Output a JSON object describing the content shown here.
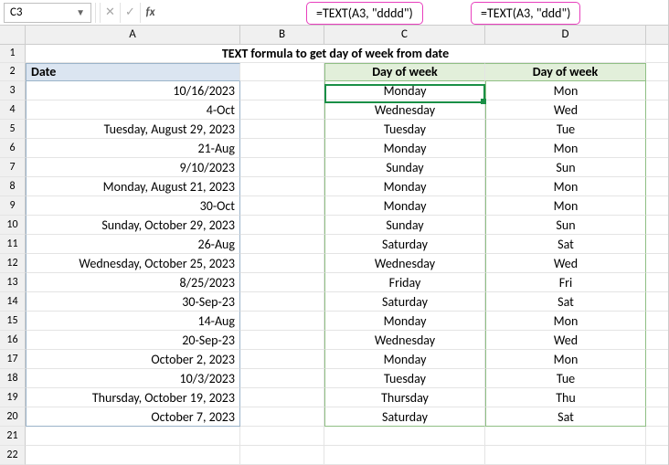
{
  "namebox": {
    "value": "C3"
  },
  "callouts": {
    "c": "=TEXT(A3, \"dddd\")",
    "d": "=TEXT(A3, \"ddd\")"
  },
  "columns": {
    "A": "A",
    "B": "B",
    "C": "C",
    "D": "D",
    "E": ""
  },
  "title": "TEXT formula to get day of week from date",
  "headers": {
    "A": "Date",
    "C": "Day of week",
    "D": "Day of week"
  },
  "rows": [
    {
      "n": "3",
      "A": "10/16/2023",
      "C": "Monday",
      "D": "Mon"
    },
    {
      "n": "4",
      "A": "4-Oct",
      "C": "Wednesday",
      "D": "Wed"
    },
    {
      "n": "5",
      "A": "Tuesday, August 29, 2023",
      "C": "Tuesday",
      "D": "Tue"
    },
    {
      "n": "6",
      "A": "21-Aug",
      "C": "Monday",
      "D": "Mon"
    },
    {
      "n": "7",
      "A": "9/10/2023",
      "C": "Sunday",
      "D": "Sun"
    },
    {
      "n": "8",
      "A": "Monday, August 21, 2023",
      "C": "Monday",
      "D": "Mon"
    },
    {
      "n": "9",
      "A": "30-Oct",
      "C": "Monday",
      "D": "Mon"
    },
    {
      "n": "10",
      "A": "Sunday, October 29, 2023",
      "C": "Sunday",
      "D": "Sun"
    },
    {
      "n": "11",
      "A": "26-Aug",
      "C": "Saturday",
      "D": "Sat"
    },
    {
      "n": "12",
      "A": "Wednesday, October 25, 2023",
      "C": "Wednesday",
      "D": "Wed"
    },
    {
      "n": "13",
      "A": "8/25/2023",
      "C": "Friday",
      "D": "Fri"
    },
    {
      "n": "14",
      "A": "30-Sep-23",
      "C": "Saturday",
      "D": "Sat"
    },
    {
      "n": "15",
      "A": "14-Aug",
      "C": "Monday",
      "D": "Mon"
    },
    {
      "n": "16",
      "A": "20-Sep-23",
      "C": "Wednesday",
      "D": "Wed"
    },
    {
      "n": "17",
      "A": "October 2, 2023",
      "C": "Monday",
      "D": "Mon"
    },
    {
      "n": "18",
      "A": "10/3/2023",
      "C": "Tuesday",
      "D": "Tue"
    },
    {
      "n": "19",
      "A": "Thursday, October 19, 2023",
      "C": "Thursday",
      "D": "Thu"
    },
    {
      "n": "20",
      "A": "October 7, 2023",
      "C": "Saturday",
      "D": "Sat"
    }
  ],
  "empty_rows": [
    "21",
    "22"
  ],
  "chart_data": {
    "type": "table",
    "title": "TEXT formula to get day of week from date",
    "columns": [
      "Date",
      "Day of week (dddd)",
      "Day of week (ddd)"
    ],
    "rows": [
      [
        "10/16/2023",
        "Monday",
        "Mon"
      ],
      [
        "4-Oct",
        "Wednesday",
        "Wed"
      ],
      [
        "Tuesday, August 29, 2023",
        "Tuesday",
        "Tue"
      ],
      [
        "21-Aug",
        "Monday",
        "Mon"
      ],
      [
        "9/10/2023",
        "Sunday",
        "Sun"
      ],
      [
        "Monday, August 21, 2023",
        "Monday",
        "Mon"
      ],
      [
        "30-Oct",
        "Monday",
        "Mon"
      ],
      [
        "Sunday, October 29, 2023",
        "Sunday",
        "Sun"
      ],
      [
        "26-Aug",
        "Saturday",
        "Sat"
      ],
      [
        "Wednesday, October 25, 2023",
        "Wednesday",
        "Wed"
      ],
      [
        "8/25/2023",
        "Friday",
        "Fri"
      ],
      [
        "30-Sep-23",
        "Saturday",
        "Sat"
      ],
      [
        "14-Aug",
        "Monday",
        "Mon"
      ],
      [
        "20-Sep-23",
        "Wednesday",
        "Wed"
      ],
      [
        "October 2, 2023",
        "Monday",
        "Mon"
      ],
      [
        "10/3/2023",
        "Tuesday",
        "Tue"
      ],
      [
        "Thursday, October 19, 2023",
        "Thursday",
        "Thu"
      ],
      [
        "October 7, 2023",
        "Saturday",
        "Sat"
      ]
    ]
  }
}
